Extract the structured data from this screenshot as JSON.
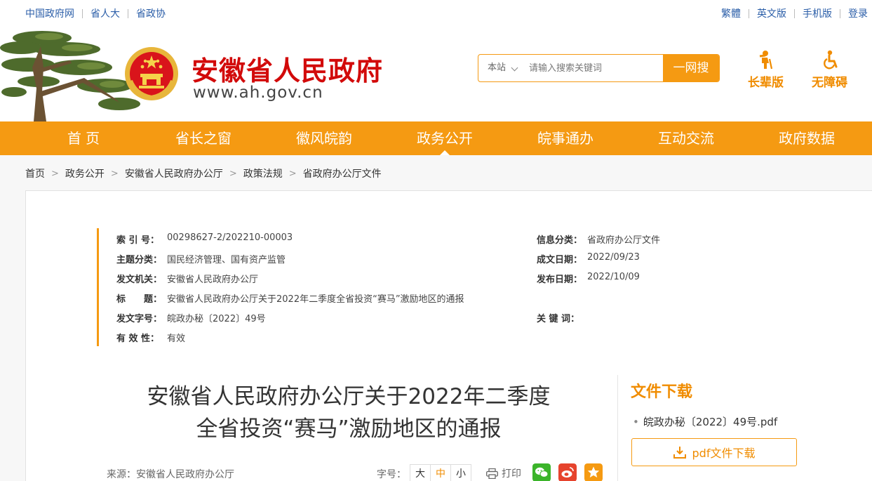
{
  "top_links_left": [
    "中国政府网",
    "省人大",
    "省政协"
  ],
  "top_links_right": [
    "繁體",
    "英文版",
    "手机版",
    "登录"
  ],
  "site": {
    "title": "安徽省人民政府",
    "url": "www.ah.gov.cn"
  },
  "search": {
    "scope": "本站",
    "placeholder": "请输入搜索关键词",
    "button": "一网搜"
  },
  "modes": {
    "elder": "长辈版",
    "accessible": "无障碍"
  },
  "nav": [
    "首 页",
    "省长之窗",
    "徽风皖韵",
    "政务公开",
    "皖事通办",
    "互动交流",
    "政府数据"
  ],
  "nav_active_index": 3,
  "breadcrumb": [
    "首页",
    "政务公开",
    "安徽省人民政府办公厅",
    "政策法规",
    "省政府办公厅文件"
  ],
  "meta": {
    "index_no": {
      "label": "索 引 号：",
      "value": "00298627-2/202210-00003"
    },
    "category": {
      "label": "信息分类：",
      "value": "省政府办公厅文件"
    },
    "subject": {
      "label": "主题分类：",
      "value": "国民经济管理、国有资产监管"
    },
    "written_date": {
      "label": "成文日期：",
      "value": "2022/09/23"
    },
    "issuer": {
      "label": "发文机关：",
      "value": "安徽省人民政府办公厅"
    },
    "publish_date": {
      "label": "发布日期：",
      "value": "2022/10/09"
    },
    "title": {
      "label": "标　　题：",
      "value": "安徽省人民政府办公厅关于2022年二季度全省投资“赛马”激励地区的通报"
    },
    "doc_no": {
      "label": "发文字号：",
      "value": "皖政办秘〔2022〕49号"
    },
    "keywords": {
      "label": "关 键 词：",
      "value": ""
    },
    "validity": {
      "label": "有 效 性：",
      "value": "有效"
    }
  },
  "document": {
    "title_line1": "安徽省人民政府办公厅关于2022年二季度",
    "title_line2": "全省投资“赛马”激励地区的通报",
    "source": "来源：安徽省人民政府办公厅",
    "font_size_label": "字号：",
    "font_sizes": [
      "大",
      "中",
      "小"
    ],
    "font_size_active": "中",
    "print": "打印"
  },
  "downloads": {
    "title": "文件下载",
    "file": "皖政办秘〔2022〕49号.pdf",
    "button": "pdf文件下载"
  },
  "colors": {
    "accent": "#f59a12",
    "brand_red": "#d20a0a",
    "link_blue": "#2b5ea8",
    "wechat": "#3bb42a",
    "weibo": "#e6432d"
  }
}
